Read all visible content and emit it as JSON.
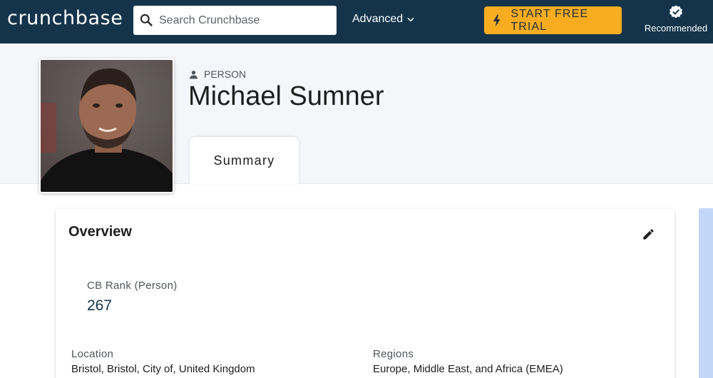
{
  "nav": {
    "logo": "crunchbase",
    "search_placeholder": "Search Crunchbase",
    "advanced_label": "Advanced",
    "trial_label": "START FREE TRIAL",
    "recommended_label": "Recommended",
    "icons": [
      "search-icon",
      "chevron-down-icon",
      "lightning-icon",
      "verified-badge-icon"
    ]
  },
  "profile": {
    "entity_type": "PERSON",
    "name": "Michael Sumner",
    "tab_label": "Summary"
  },
  "overview": {
    "title": "Overview",
    "cb_rank_label": "CB Rank (Person)",
    "cb_rank_value": "267",
    "location_label": "Location",
    "location_value": "Bristol, Bristol, City of, United Kingdom",
    "regions_label": "Regions",
    "regions_value": "Europe, Middle East, and Africa (EMEA)"
  },
  "colors": {
    "nav_bg": "#14344b",
    "accent": "#f8ac1f",
    "band_bg": "#f4f6fa",
    "side_panel": "#c2d6f8"
  }
}
